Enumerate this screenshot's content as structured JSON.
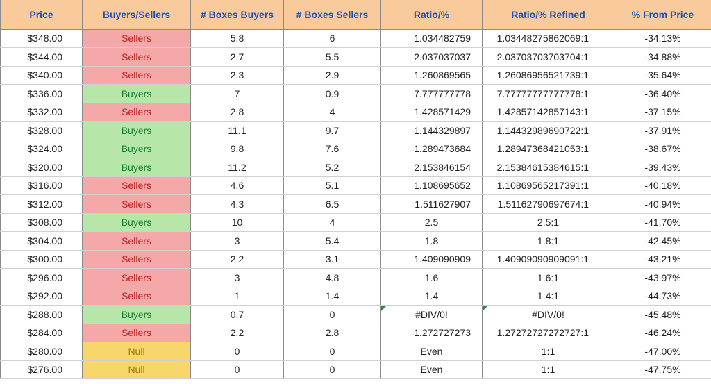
{
  "headers": {
    "price": "Price",
    "bs": "Buyers/Sellers",
    "boxes_buyers": "# Boxes Buyers",
    "boxes_sellers": "# Boxes Sellers",
    "ratio": "Ratio/%",
    "ratio_refined": "Ratio/% Refined",
    "pct_from_price": "% From Price"
  },
  "rows": [
    {
      "price": "$348.00",
      "bs": "Sellers",
      "bs_kind": "sellers",
      "bb": "5.8",
      "bsell": "6",
      "ratio": "1.034482759",
      "refined": "1.03448275862069:1",
      "pct": "-34.13%"
    },
    {
      "price": "$344.00",
      "bs": "Sellers",
      "bs_kind": "sellers",
      "bb": "2.7",
      "bsell": "5.5",
      "ratio": "2.037037037",
      "refined": "2.03703703703704:1",
      "pct": "-34.88%"
    },
    {
      "price": "$340.00",
      "bs": "Sellers",
      "bs_kind": "sellers",
      "bb": "2.3",
      "bsell": "2.9",
      "ratio": "1.260869565",
      "refined": "1.26086956521739:1",
      "pct": "-35.64%"
    },
    {
      "price": "$336.00",
      "bs": "Buyers",
      "bs_kind": "buyers",
      "bb": "7",
      "bsell": "0.9",
      "ratio": "7.777777778",
      "refined": "7.77777777777778:1",
      "pct": "-36.40%"
    },
    {
      "price": "$332.00",
      "bs": "Sellers",
      "bs_kind": "sellers",
      "bb": "2.8",
      "bsell": "4",
      "ratio": "1.428571429",
      "refined": "1.42857142857143:1",
      "pct": "-37.15%"
    },
    {
      "price": "$328.00",
      "bs": "Buyers",
      "bs_kind": "buyers",
      "bb": "11.1",
      "bsell": "9.7",
      "ratio": "1.144329897",
      "refined": "1.14432989690722:1",
      "pct": "-37.91%"
    },
    {
      "price": "$324.00",
      "bs": "Buyers",
      "bs_kind": "buyers",
      "bb": "9.8",
      "bsell": "7.6",
      "ratio": "1.289473684",
      "refined": "1.28947368421053:1",
      "pct": "-38.67%"
    },
    {
      "price": "$320.00",
      "bs": "Buyers",
      "bs_kind": "buyers",
      "bb": "11.2",
      "bsell": "5.2",
      "ratio": "2.153846154",
      "refined": "2.15384615384615:1",
      "pct": "-39.43%"
    },
    {
      "price": "$316.00",
      "bs": "Sellers",
      "bs_kind": "sellers",
      "bb": "4.6",
      "bsell": "5.1",
      "ratio": "1.108695652",
      "refined": "1.10869565217391:1",
      "pct": "-40.18%"
    },
    {
      "price": "$312.00",
      "bs": "Sellers",
      "bs_kind": "sellers",
      "bb": "4.3",
      "bsell": "6.5",
      "ratio": "1.511627907",
      "refined": "1.51162790697674:1",
      "pct": "-40.94%"
    },
    {
      "price": "$308.00",
      "bs": "Buyers",
      "bs_kind": "buyers",
      "bb": "10",
      "bsell": "4",
      "ratio": "2.5",
      "ratio_center": true,
      "refined": "2.5:1",
      "refined_center": true,
      "pct": "-41.70%"
    },
    {
      "price": "$304.00",
      "bs": "Sellers",
      "bs_kind": "sellers",
      "bb": "3",
      "bsell": "5.4",
      "ratio": "1.8",
      "ratio_center": true,
      "refined": "1.8:1",
      "refined_center": true,
      "pct": "-42.45%"
    },
    {
      "price": "$300.00",
      "bs": "Sellers",
      "bs_kind": "sellers",
      "bb": "2.2",
      "bsell": "3.1",
      "ratio": "1.409090909",
      "refined": "1.40909090909091:1",
      "pct": "-43.21%"
    },
    {
      "price": "$296.00",
      "bs": "Sellers",
      "bs_kind": "sellers",
      "bb": "3",
      "bsell": "4.8",
      "ratio": "1.6",
      "ratio_center": true,
      "refined": "1.6:1",
      "refined_center": true,
      "pct": "-43.97%"
    },
    {
      "price": "$292.00",
      "bs": "Sellers",
      "bs_kind": "sellers",
      "bb": "1",
      "bsell": "1.4",
      "ratio": "1.4",
      "ratio_center": true,
      "refined": "1.4:1",
      "refined_center": true,
      "pct": "-44.73%"
    },
    {
      "price": "$288.00",
      "bs": "Buyers",
      "bs_kind": "buyers",
      "bb": "0.7",
      "bsell": "0",
      "ratio": "#DIV/0!",
      "ratio_center": true,
      "ratio_err": true,
      "refined": "#DIV/0!",
      "refined_center": true,
      "refined_err": true,
      "pct": "-45.48%"
    },
    {
      "price": "$284.00",
      "bs": "Sellers",
      "bs_kind": "sellers",
      "bb": "2.2",
      "bsell": "2.8",
      "ratio": "1.272727273",
      "refined": "1.27272727272727:1",
      "pct": "-46.24%"
    },
    {
      "price": "$280.00",
      "bs": "Null",
      "bs_kind": "null",
      "bb": "0",
      "bsell": "0",
      "ratio": "Even",
      "ratio_center": true,
      "refined": "1:1",
      "refined_center": true,
      "pct": "-47.00%"
    },
    {
      "price": "$276.00",
      "bs": "Null",
      "bs_kind": "null",
      "bb": "0",
      "bsell": "0",
      "ratio": "Even",
      "ratio_center": true,
      "refined": "1:1",
      "refined_center": true,
      "pct": "-47.75%"
    }
  ]
}
